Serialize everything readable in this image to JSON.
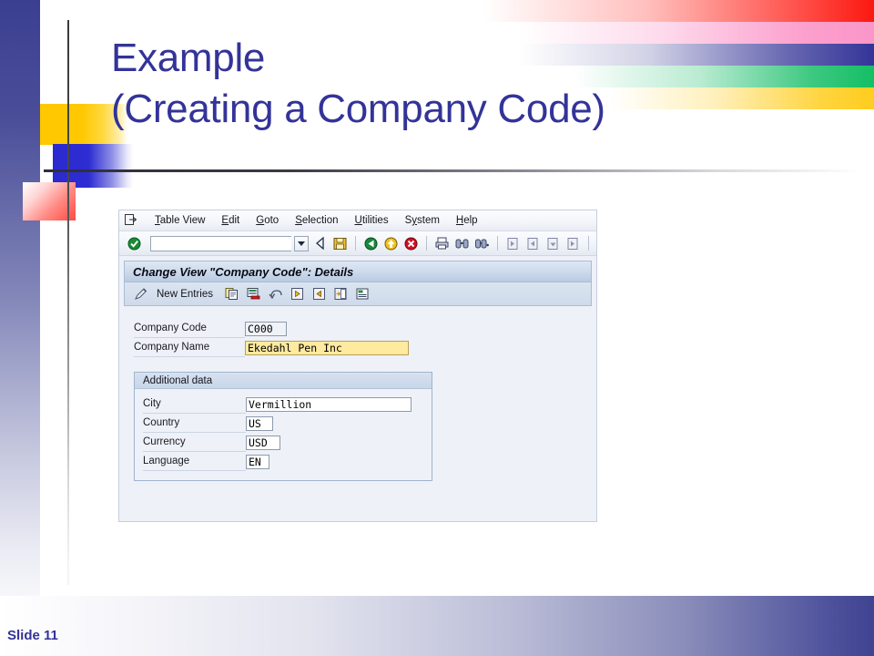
{
  "slide": {
    "title": "Example\n(Creating a Company Code)",
    "title_line1": "Example",
    "title_line2": "(Creating a Company Code)",
    "slide_number": "Slide 11",
    "title_color": "#333399",
    "accent_bars": [
      {
        "name": "red-bar",
        "color": "#fb1810"
      },
      {
        "name": "pink-bar",
        "color": "#fb96c8"
      },
      {
        "name": "blue-bar",
        "color": "#343499"
      },
      {
        "name": "green-bar",
        "color": "#14bf64"
      },
      {
        "name": "yellow-bar",
        "color": "#ffcd1e"
      }
    ],
    "decorations": [
      {
        "name": "yellow-block",
        "color": "#ffc800"
      },
      {
        "name": "blue-block",
        "color": "#2a2ad0"
      },
      {
        "name": "red-block",
        "color": "#ff4a42"
      }
    ]
  },
  "sap": {
    "system_menu_icon": "exit-box-icon",
    "menu": [
      {
        "label": "Table View",
        "accel": "T"
      },
      {
        "label": "Edit",
        "accel": "E"
      },
      {
        "label": "Goto",
        "accel": "G"
      },
      {
        "label": "Selection",
        "accel": "S"
      },
      {
        "label": "Utilities",
        "accel": "U"
      },
      {
        "label": "System",
        "accel": "y"
      },
      {
        "label": "Help",
        "accel": "H"
      }
    ],
    "command_field": {
      "value": "",
      "placeholder": ""
    },
    "toolbar_icons": [
      "enter-check-icon",
      "back-triangle-icon",
      "save-disk-icon",
      "back-green-icon",
      "exit-yellow-icon",
      "cancel-red-icon",
      "print-icon",
      "find-icon",
      "find-next-icon",
      "first-page-icon",
      "previous-page-icon",
      "next-page-icon",
      "last-page-icon"
    ],
    "title_bar": "Change View \"Company Code\": Details",
    "app_toolbar": {
      "new_entries_icon": "pencil-icon",
      "new_entries_label": "New Entries",
      "icons": [
        "copy-icon",
        "delete-row-icon",
        "undo-icon",
        "previous-entry-icon",
        "next-entry-icon",
        "details-icon",
        "display-list-icon"
      ]
    },
    "form": {
      "fields": [
        {
          "label": "Company Code",
          "value": "C000",
          "state": "readonly",
          "width": 46
        },
        {
          "label": "Company Name",
          "value": "Ekedahl Pen Inc",
          "state": "focused",
          "width": 180
        }
      ]
    },
    "group": {
      "title": "Additional data",
      "fields": [
        {
          "label": "City",
          "value": "Vermillion",
          "width": 182
        },
        {
          "label": "Country",
          "value": "US",
          "width": 30
        },
        {
          "label": "Currency",
          "value": "USD",
          "width": 38
        },
        {
          "label": "Language",
          "value": "EN",
          "width": 26
        }
      ]
    }
  }
}
